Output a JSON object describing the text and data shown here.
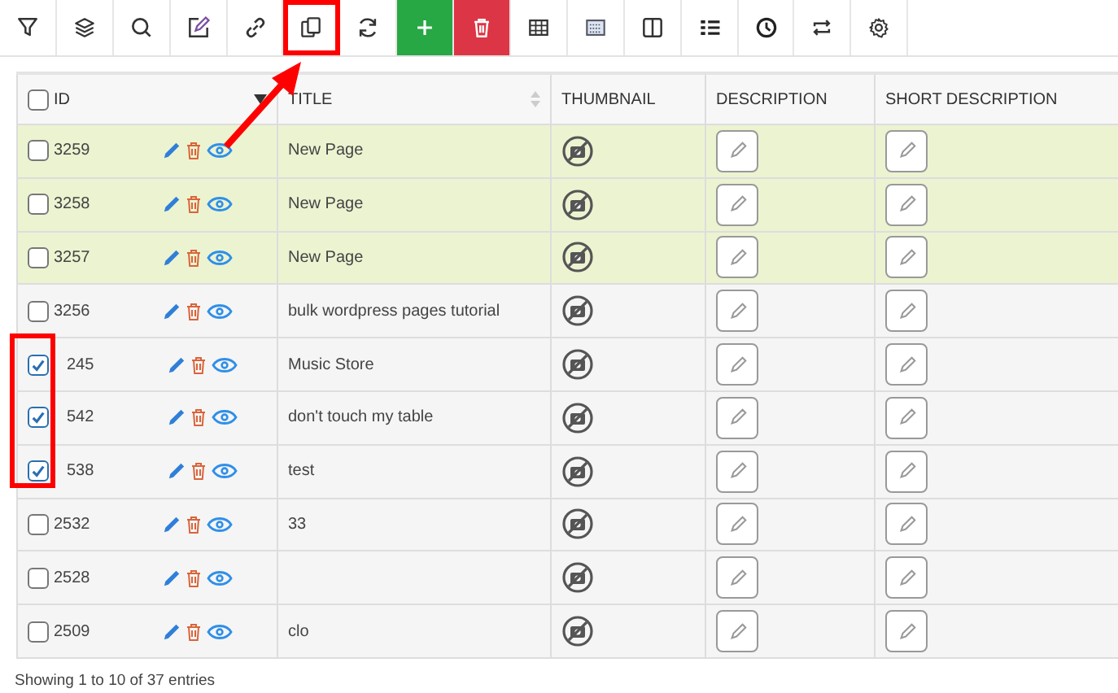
{
  "toolbar": [
    {
      "kind": "filter",
      "outlined": false
    },
    {
      "kind": "layers",
      "outlined": false
    },
    {
      "kind": "search",
      "outlined": false
    },
    {
      "kind": "edit",
      "outlined": false
    },
    {
      "kind": "link",
      "outlined": false
    },
    {
      "kind": "duplicate",
      "outlined": true
    },
    {
      "kind": "refresh",
      "outlined": false
    },
    {
      "kind": "add",
      "outlined": false
    },
    {
      "kind": "delete",
      "outlined": false
    },
    {
      "kind": "table",
      "outlined": false
    },
    {
      "kind": "keyboard",
      "outlined": false
    },
    {
      "kind": "columns",
      "outlined": false
    },
    {
      "kind": "list",
      "outlined": false
    },
    {
      "kind": "history",
      "outlined": false
    },
    {
      "kind": "swap",
      "outlined": false
    },
    {
      "kind": "settings",
      "outlined": false
    }
  ],
  "table": {
    "columns": [
      "ID",
      "TITLE",
      "THUMBNAIL",
      "DESCRIPTION",
      "SHORT DESCRIPTION"
    ],
    "header_checked": false,
    "rows": [
      {
        "id": "3259",
        "title": "New Page",
        "checked": false,
        "highlighted": true,
        "outlined": false
      },
      {
        "id": "3258",
        "title": "New Page",
        "checked": false,
        "highlighted": true,
        "outlined": false
      },
      {
        "id": "3257",
        "title": "New Page",
        "checked": false,
        "highlighted": true,
        "outlined": false
      },
      {
        "id": "3256",
        "title": "bulk wordpress pages tutorial",
        "checked": false,
        "highlighted": false,
        "outlined": false
      },
      {
        "id": "245",
        "title": "Music Store",
        "checked": true,
        "highlighted": false,
        "outlined": true
      },
      {
        "id": "542",
        "title": "don't touch my table",
        "checked": true,
        "highlighted": false,
        "outlined": true
      },
      {
        "id": "538",
        "title": "test",
        "checked": true,
        "highlighted": false,
        "outlined": true
      },
      {
        "id": "2532",
        "title": "33",
        "checked": false,
        "highlighted": false,
        "outlined": false
      },
      {
        "id": "2528",
        "title": "",
        "checked": false,
        "highlighted": false,
        "outlined": false
      },
      {
        "id": "2509",
        "title": "clo",
        "checked": false,
        "highlighted": false,
        "outlined": false
      }
    ]
  },
  "footer": "Showing 1 to 10 of 37 entries"
}
